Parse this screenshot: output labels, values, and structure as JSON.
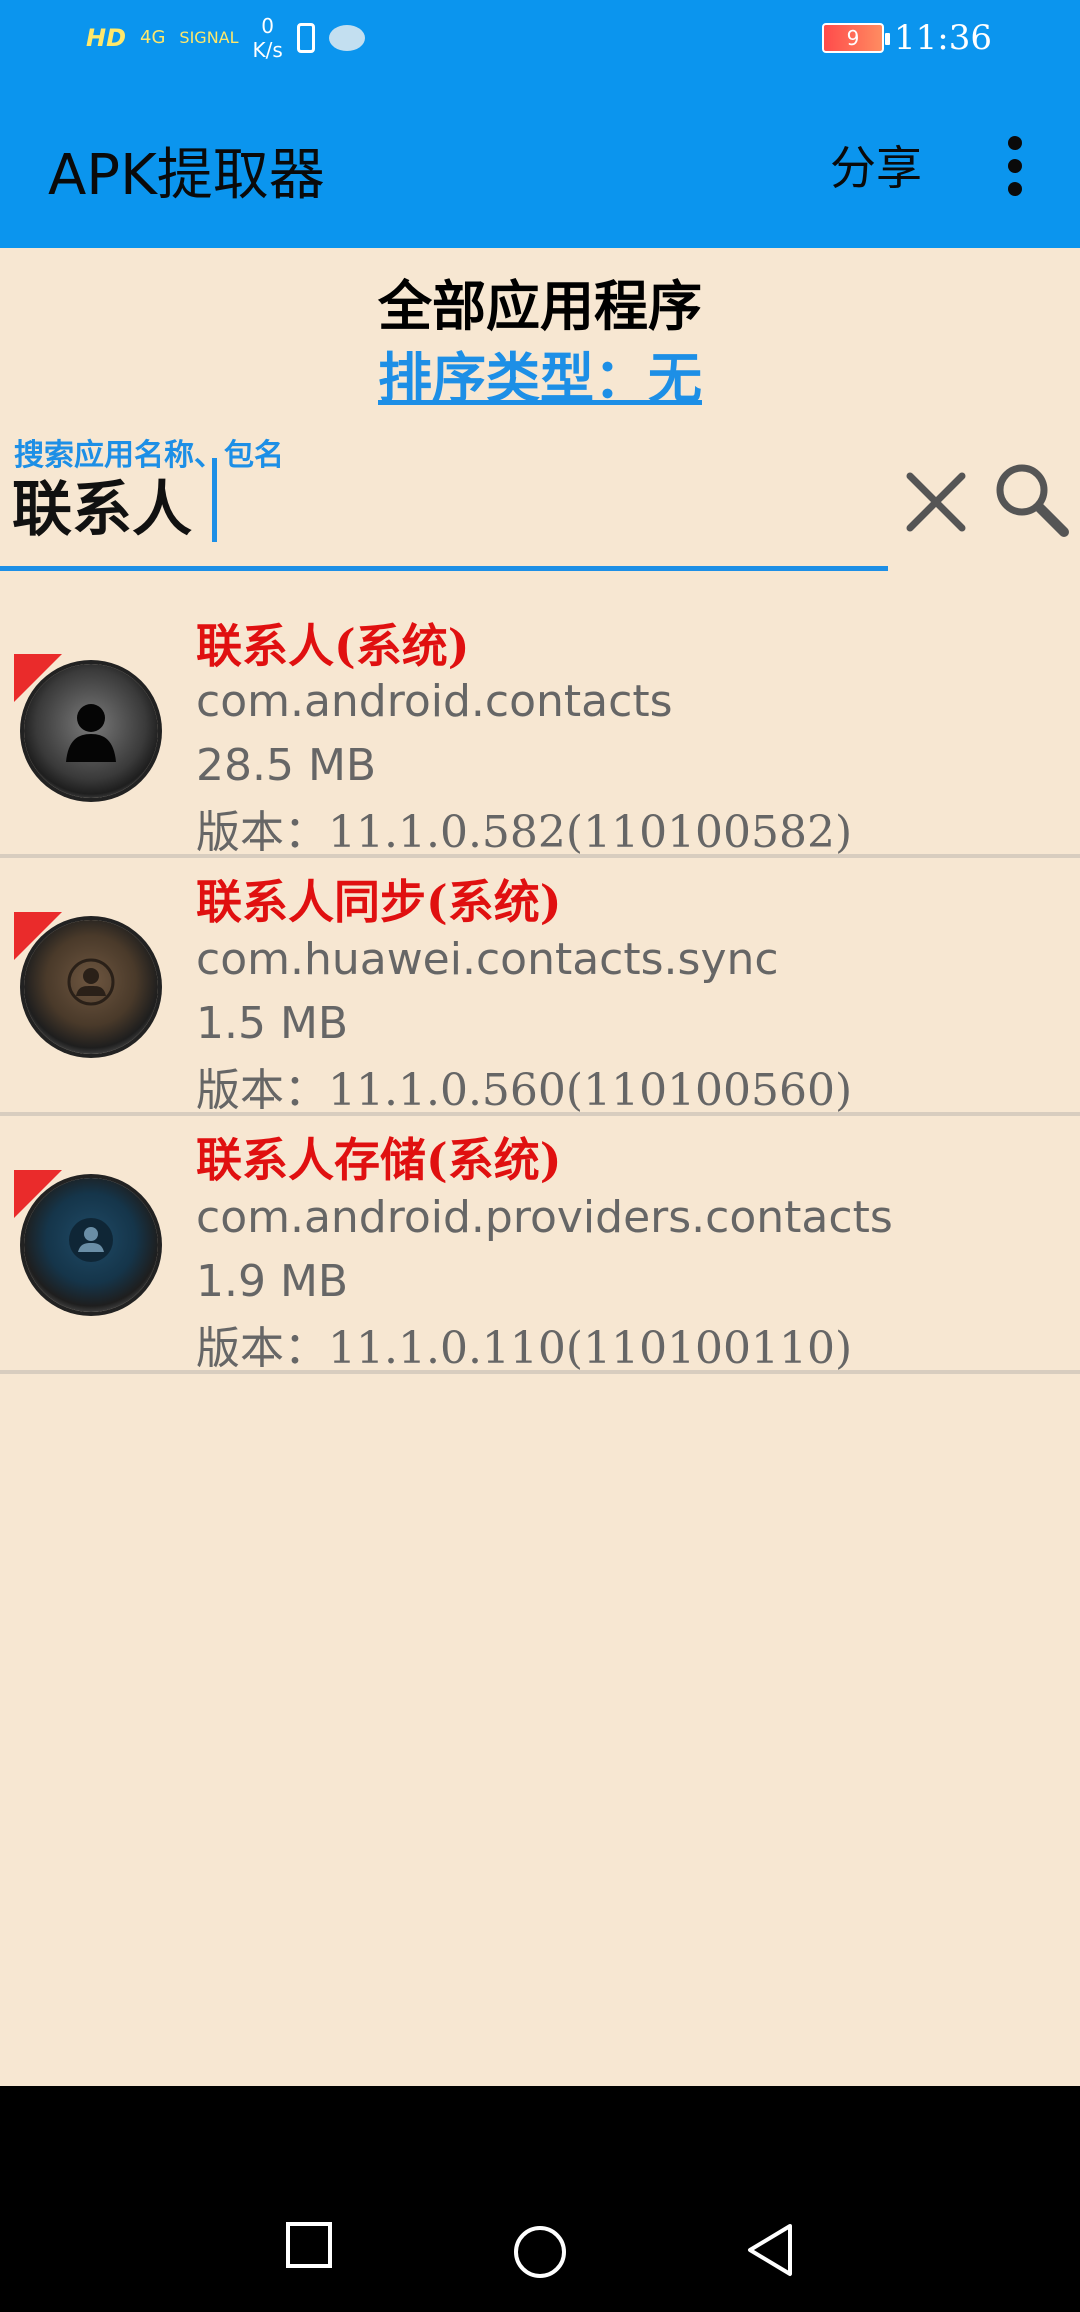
{
  "status_bar": {
    "hd": "HD",
    "network": "4G",
    "signal": "SIGNAL",
    "speed_value": "0",
    "speed_unit": "K/s",
    "battery": "9",
    "time": "11:36"
  },
  "app_bar": {
    "title": "APK提取器",
    "share_label": "分享"
  },
  "header": {
    "title": "全部应用程序",
    "sort_label": "排序类型：无"
  },
  "search": {
    "hint": "搜索应用名称、包名",
    "value": "联系人"
  },
  "apps": [
    {
      "name": "联系人(系统)",
      "package": "com.android.contacts",
      "size": "28.5 MB",
      "version": "版本：11.1.0.582(110100582)"
    },
    {
      "name": "联系人同步(系统)",
      "package": "com.huawei.contacts.sync",
      "size": "1.5 MB",
      "version": "版本：11.1.0.560(110100560)"
    },
    {
      "name": "联系人存储(系统)",
      "package": "com.android.providers.contacts",
      "size": "1.9 MB",
      "version": "版本：11.1.0.110(110100110)"
    }
  ],
  "icons": {
    "menu": "more-vert-icon",
    "clear": "close-icon",
    "search": "search-icon",
    "nav_recents": "square-icon",
    "nav_home": "circle-icon",
    "nav_back": "triangle-back-icon"
  },
  "colors": {
    "app_bar": "#0b95ee",
    "background": "#f7e7d2",
    "accent": "#1d8fe6",
    "system_app_name": "#e01010"
  }
}
